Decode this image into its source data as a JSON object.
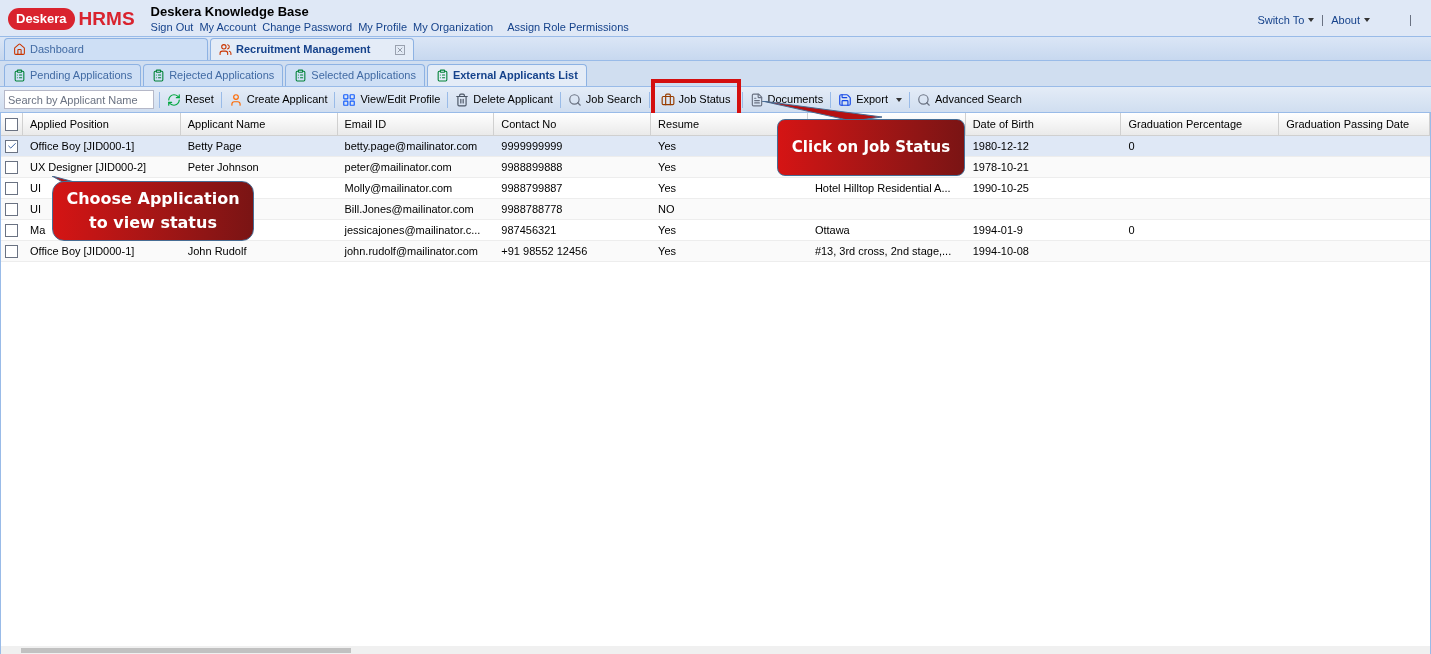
{
  "logo": {
    "brand": "Deskera",
    "product": "HRMS"
  },
  "header": {
    "title": "Deskera Knowledge Base",
    "links": [
      "Sign Out",
      "My Account",
      "Change Password",
      "My Profile",
      "My Organization",
      "Assign Role Permissions"
    ],
    "menus": [
      "Switch To",
      "About"
    ]
  },
  "tabs": [
    {
      "label": "Dashboard",
      "selected": false,
      "closable": false
    },
    {
      "label": "Recruitment Management",
      "selected": true,
      "closable": true
    }
  ],
  "subtabs": [
    {
      "label": "Pending Applications",
      "selected": false
    },
    {
      "label": "Rejected Applications",
      "selected": false
    },
    {
      "label": "Selected Applications",
      "selected": false
    },
    {
      "label": "External Applicants List",
      "selected": true
    }
  ],
  "toolbar": {
    "search": {
      "placeholder": "Search by Applicant Name"
    },
    "buttons": [
      {
        "label": "Reset",
        "dropdown": false,
        "highlighted": false
      },
      {
        "label": "Create Applicant",
        "dropdown": false,
        "highlighted": false
      },
      {
        "label": "View/Edit Profile",
        "dropdown": false,
        "highlighted": false
      },
      {
        "label": "Delete Applicant",
        "dropdown": false,
        "highlighted": false
      },
      {
        "label": "Job Search",
        "dropdown": false,
        "highlighted": false
      },
      {
        "label": "Job Status",
        "dropdown": false,
        "highlighted": true
      },
      {
        "label": "Documents",
        "dropdown": false,
        "highlighted": false
      },
      {
        "label": "Export",
        "dropdown": true,
        "highlighted": false
      },
      {
        "label": "Advanced Search",
        "dropdown": false,
        "highlighted": false
      }
    ]
  },
  "table": {
    "all_selected": false,
    "columns": [
      "Applied Position",
      "Applicant Name",
      "Email ID",
      "Contact No",
      "Resume",
      "",
      "Date of Birth",
      "Graduation Percentage",
      "Graduation Passing Date"
    ],
    "rows": [
      {
        "selected": true,
        "cells": [
          "Office Boy [JID000-1]",
          "Betty Page",
          "betty.page@mailinator.com",
          "9999999999",
          "Yes",
          "",
          "1980-12-12",
          "0",
          ""
        ]
      },
      {
        "selected": false,
        "cells": [
          "UX Designer [JID000-2]",
          "Peter Johnson",
          "peter@mailinator.com",
          "9988899888",
          "Yes",
          "",
          "1978-10-21",
          "",
          ""
        ]
      },
      {
        "selected": false,
        "cells": [
          "UI",
          "",
          "Molly@mailinator.com",
          "9988799887",
          "Yes",
          "Hotel Hilltop Residential A...",
          "1990-10-25",
          "",
          ""
        ]
      },
      {
        "selected": false,
        "cells": [
          "UI",
          "",
          "Bill.Jones@mailinator.com",
          "9988788778",
          "NO",
          "",
          "",
          "",
          ""
        ]
      },
      {
        "selected": false,
        "cells": [
          "Ma",
          "",
          "jessicajones@mailinator.c...",
          "987456321",
          "Yes",
          "Ottawa",
          "1994-01-9",
          "0",
          ""
        ]
      },
      {
        "selected": false,
        "cells": [
          "Office Boy [JID000-1]",
          "John Rudolf",
          "john.rudolf@mailinator.com",
          "+91 98552 12456",
          "Yes",
          "#13, 3rd cross, 2nd stage,...",
          "1994-10-08",
          "",
          ""
        ]
      }
    ]
  },
  "callouts": [
    {
      "text": "Choose Application\nto view status"
    },
    {
      "text": "Click on Job Status"
    }
  ]
}
